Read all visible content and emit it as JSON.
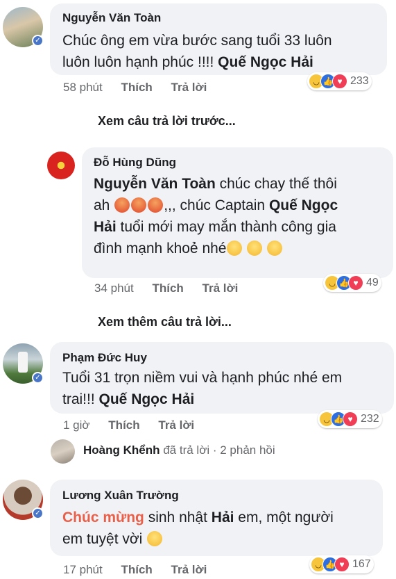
{
  "comments": [
    {
      "author": "Nguyễn Văn Toàn",
      "line1": "Chúc ông em vừa bước sang tuổi 33 luôn",
      "line2_pre": "luôn luôn hạnh phúc !!!! ",
      "line2_tag": "Quế Ngọc Hải",
      "time": "58 phút",
      "like": "Thích",
      "reply": "Trả lời",
      "reaction_count": "233"
    },
    {
      "author": "Đỗ Hùng Dũng",
      "line1_tag": "Nguyễn Văn Toàn",
      "line1_post": "  chúc chay thế thôi",
      "line2_pre": "ah ",
      "line2_mid": ",,, chúc Captain ",
      "line2_tag": "Quế Ngọc",
      "line3_tag": "Hải",
      "line3_post": " tuổi mới may mắn thành công gia",
      "line4": "đình mạnh khoẻ nhé",
      "time": "34 phút",
      "like": "Thích",
      "reply": "Trả lời",
      "reaction_count": "49"
    },
    {
      "author": "Phạm Đức Huy",
      "line1": "Tuổi 31 trọn niềm vui và hạnh phúc nhé em",
      "line2_pre": "trai!!! ",
      "line2_tag": "Quế Ngọc Hải",
      "time": "1 giờ",
      "like": "Thích",
      "reply": "Trả lời",
      "reaction_count": "232"
    },
    {
      "author": "Lương Xuân Trường",
      "line1_highlight": "Chúc mừng",
      "line1_mid": " sinh nhật ",
      "line1_tag": "Hải",
      "line1_post": " em, một người",
      "line2": "em tuyệt vời ",
      "time": "17 phút",
      "like": "Thích",
      "reply": "Trả lời",
      "reaction_count": "167"
    }
  ],
  "view_previous": "Xem câu trả lời trước...",
  "view_more": "Xem thêm câu trả lời...",
  "reply_summary": {
    "author": "Hoàng Khểnh",
    "action": " đã trả lời · ",
    "count": "2 phản hồi"
  },
  "colors": {
    "bubble": "#f0f2f5",
    "highlight": "#e9604a",
    "like": "#2d6fe0",
    "love": "#ef3e55",
    "haha": "#f7c53c",
    "verified": "#4a76c8"
  },
  "icons": [
    "verified-badge-icon",
    "haha-reaction-icon",
    "like-reaction-icon",
    "love-reaction-icon",
    "angry-emoji-icon",
    "grin-emoji-icon",
    "kiss-emoji-icon"
  ]
}
